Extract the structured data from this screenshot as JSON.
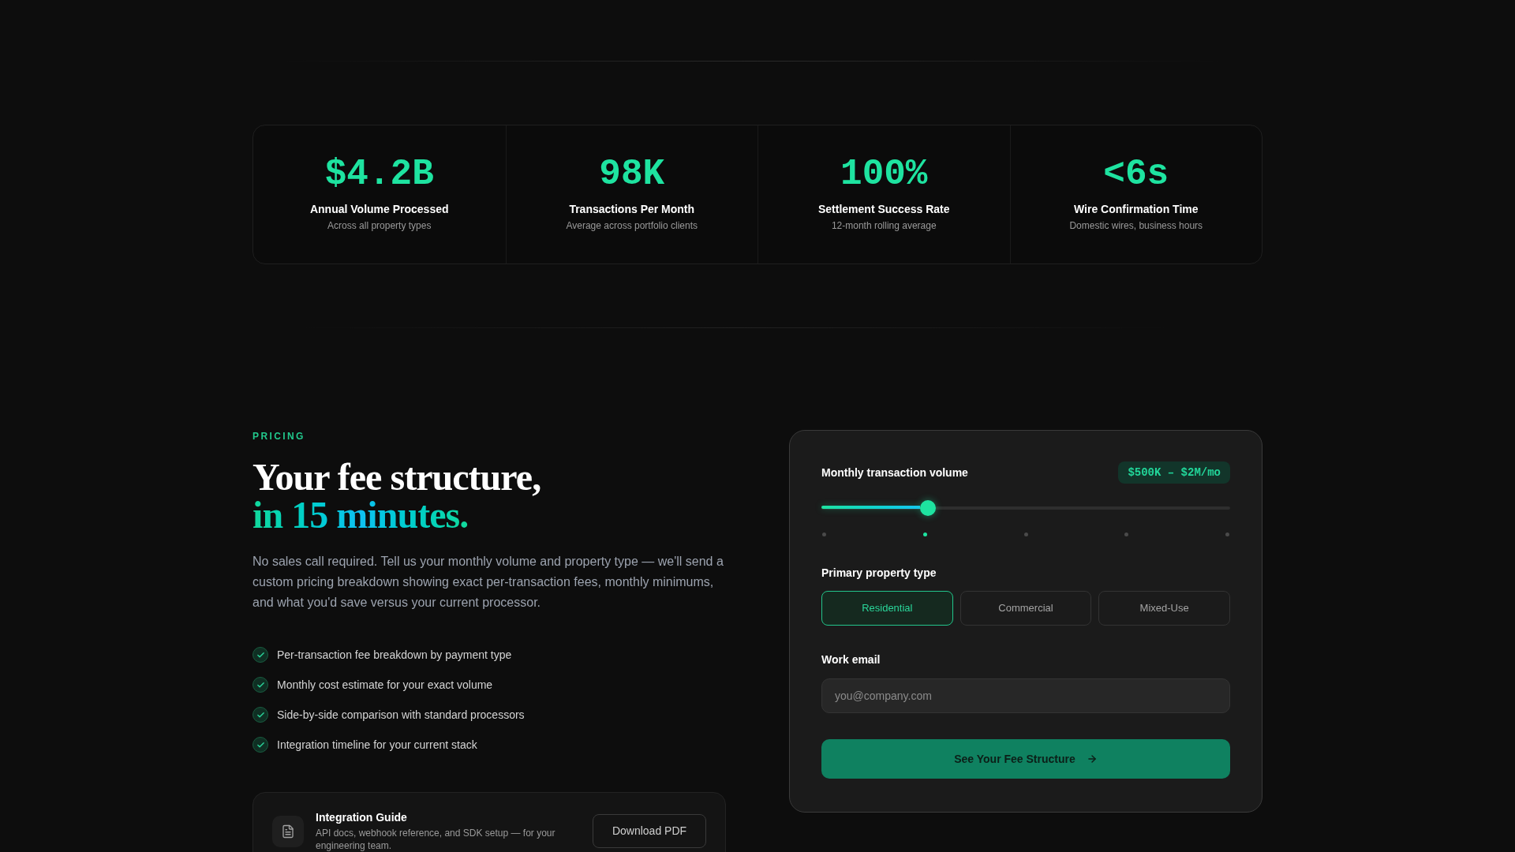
{
  "stats": [
    {
      "value": "$4.2B",
      "label": "Annual Volume Processed",
      "note": "Across all property types"
    },
    {
      "value": "98K",
      "label": "Transactions Per Month",
      "note": "Average across portfolio clients"
    },
    {
      "value": "100%",
      "label": "Settlement Success Rate",
      "note": "12-month rolling average"
    },
    {
      "value": "<6s",
      "label": "Wire Confirmation Time",
      "note": "Domestic wires, business hours"
    }
  ],
  "pricing": {
    "eyebrow": "PRICING",
    "title": "Your fee structure,",
    "title_accent": "in 15 minutes.",
    "description": "No sales call required. Tell us your monthly volume and property type — we'll send a custom pricing breakdown showing exact per-transaction fees, monthly minimums, and what you'd save versus your current processor.",
    "features": [
      "Per-transaction fee breakdown by payment type",
      "Monthly cost estimate for your exact volume",
      "Side-by-side comparison with standard processors",
      "Integration timeline for your current stack"
    ],
    "guide": {
      "title": "Integration Guide",
      "description": "API docs, webhook reference, and SDK setup — for your engineering team.",
      "button": "Download PDF"
    }
  },
  "calculator": {
    "volume": {
      "label": "Monthly transaction volume",
      "reading": "$500K – $2M/mo",
      "level": 0.25,
      "stops": [
        {
          "selected": false
        },
        {
          "selected": true
        },
        {
          "selected": false
        },
        {
          "selected": false
        },
        {
          "selected": false
        }
      ]
    },
    "property_type": {
      "label": "Primary property type",
      "options": [
        {
          "label": "Residential",
          "selected": true
        },
        {
          "label": "Commercial",
          "selected": false
        },
        {
          "label": "Mixed-Use",
          "selected": false
        }
      ]
    },
    "email": {
      "label": "Work email",
      "placeholder": "you@company.com"
    },
    "submit": "See Your Fee Structure"
  }
}
